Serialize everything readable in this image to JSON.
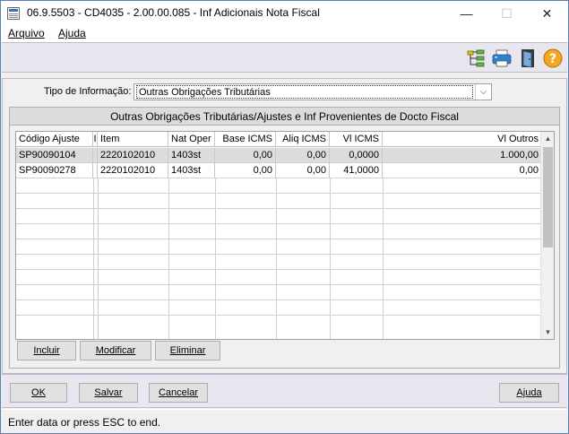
{
  "window": {
    "title": "06.9.5503 - CD4035 - 2.00.00.085 - Inf Adicionais Nota Fiscal",
    "minimize_glyph": "—",
    "maximize_glyph": "☐",
    "close_glyph": "✕"
  },
  "menu": {
    "items": [
      {
        "label": "Arquivo",
        "mnemonic": "A"
      },
      {
        "label": "Ajuda",
        "mnemonic": "A"
      }
    ]
  },
  "toolbar": {
    "icons": [
      "tree-icon",
      "printer-icon",
      "exit-door-icon",
      "help-icon"
    ],
    "help_glyph": "?"
  },
  "form": {
    "tipo_label": "Tipo de Informação:",
    "tipo_value": "Outras Obrigações Tributárias",
    "dropdown_glyph": "⌵"
  },
  "group": {
    "title": "Outras Obrigações Tributárias/Ajustes e Inf Provenientes de Docto Fiscal"
  },
  "grid": {
    "columns": [
      "Código Ajuste",
      "I",
      "Item",
      "Nat Oper",
      "Base ICMS",
      "Aliq ICMS",
      "Vl ICMS",
      "Vl Outros"
    ],
    "rows": [
      {
        "codigo": "SP90090104",
        "i": "",
        "item": "2220102010",
        "nat_oper": "1403st",
        "base_icms": "0,00",
        "aliq_icms": "0,00",
        "vl_icms": "0,0000",
        "vl_outros": "1.000,00",
        "selected": true
      },
      {
        "codigo": "SP90090278",
        "i": "",
        "item": "2220102010",
        "nat_oper": "1403st",
        "base_icms": "0,00",
        "aliq_icms": "0,00",
        "vl_icms": "41,0000",
        "vl_outros": "0,00",
        "selected": false
      }
    ],
    "scroll_up_glyph": "▲",
    "scroll_down_glyph": "▼"
  },
  "buttons": {
    "incluir": "Incluir",
    "modificar": "Modificar",
    "eliminar": "Eliminar",
    "ok": "OK",
    "salvar": "Salvar",
    "cancelar": "Cancelar",
    "ajuda": "Ajuda"
  },
  "status": {
    "text": "Enter data or press ESC to end."
  },
  "colors": {
    "selected_row": "#dcdcdc",
    "toolbar_bg": "#e8e6ee",
    "help_icon": "#f5a623",
    "print_icon": "#2f7fd0"
  }
}
